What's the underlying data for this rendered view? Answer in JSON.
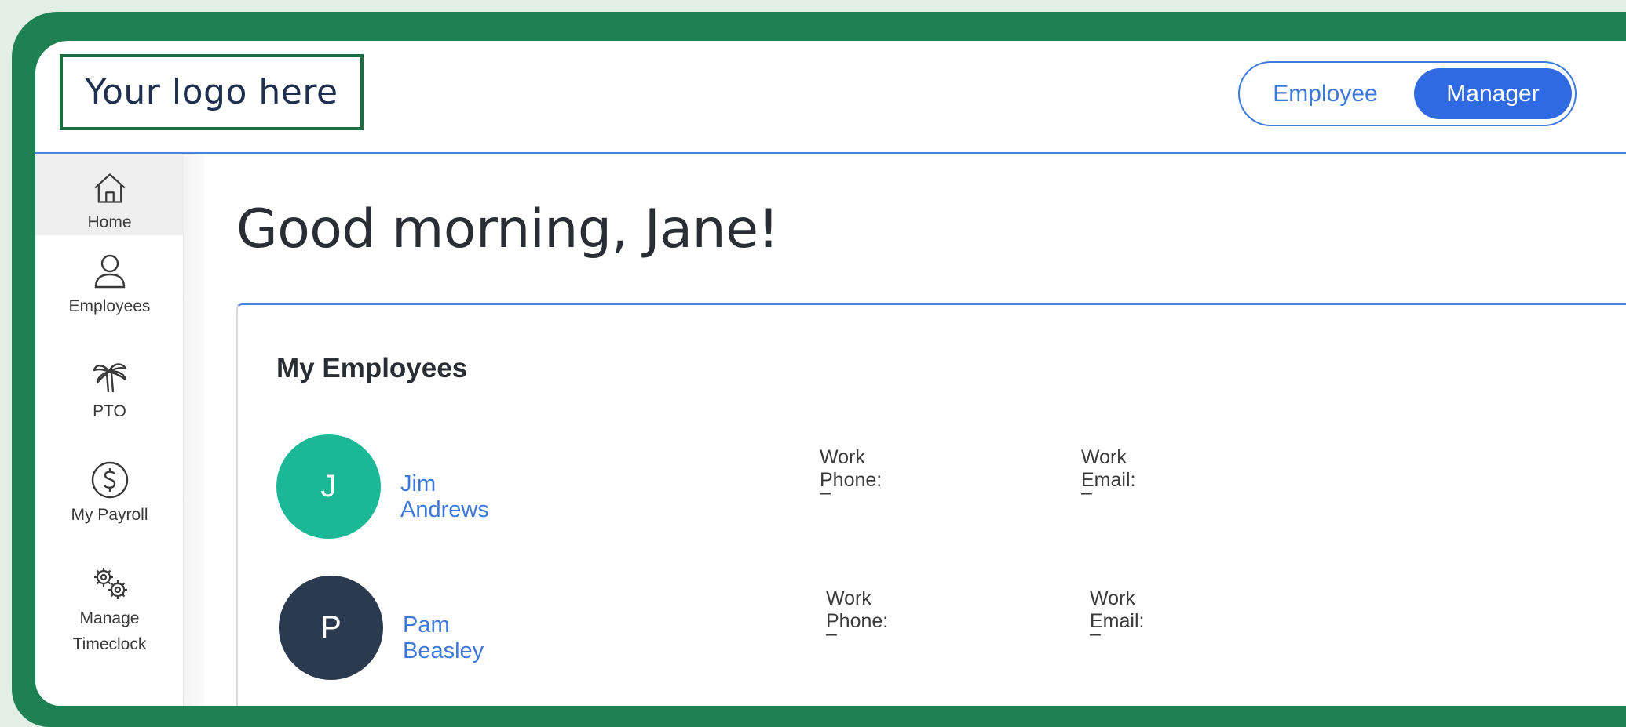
{
  "header": {
    "logo_text": "Your logo here",
    "toggle": {
      "employee_label": "Employee",
      "manager_label": "Manager",
      "selected": "Manager"
    }
  },
  "sidebar": {
    "items": [
      {
        "label": "Home",
        "icon": "home-icon"
      },
      {
        "label": "Employees",
        "icon": "person-icon"
      },
      {
        "label": "PTO",
        "icon": "palm-tree-icon"
      },
      {
        "label": "My Payroll",
        "icon": "dollar-circle-icon"
      },
      {
        "label": "Manage Timeclock",
        "icon": "gears-icon"
      }
    ],
    "active": "Home"
  },
  "main": {
    "greeting": "Good morning, Jane!",
    "card": {
      "title": "My Employees",
      "employees": [
        {
          "initial": "J",
          "name": "Jim Andrews",
          "phone_label": "Work Phone:",
          "phone_value": "–",
          "email_label": "Work Email:",
          "email_value": "–",
          "avatar_color": "#1ab896"
        },
        {
          "initial": "P",
          "name": "Pam Beasley",
          "phone_label": "Work Phone:",
          "phone_value": "–",
          "email_label": "Work Email:",
          "email_value": "–",
          "avatar_color": "#2b3a4e"
        }
      ]
    }
  },
  "colors": {
    "frame_green": "#1e8154",
    "accent_blue": "#2f6ae3",
    "link_blue": "#3e78d8"
  }
}
